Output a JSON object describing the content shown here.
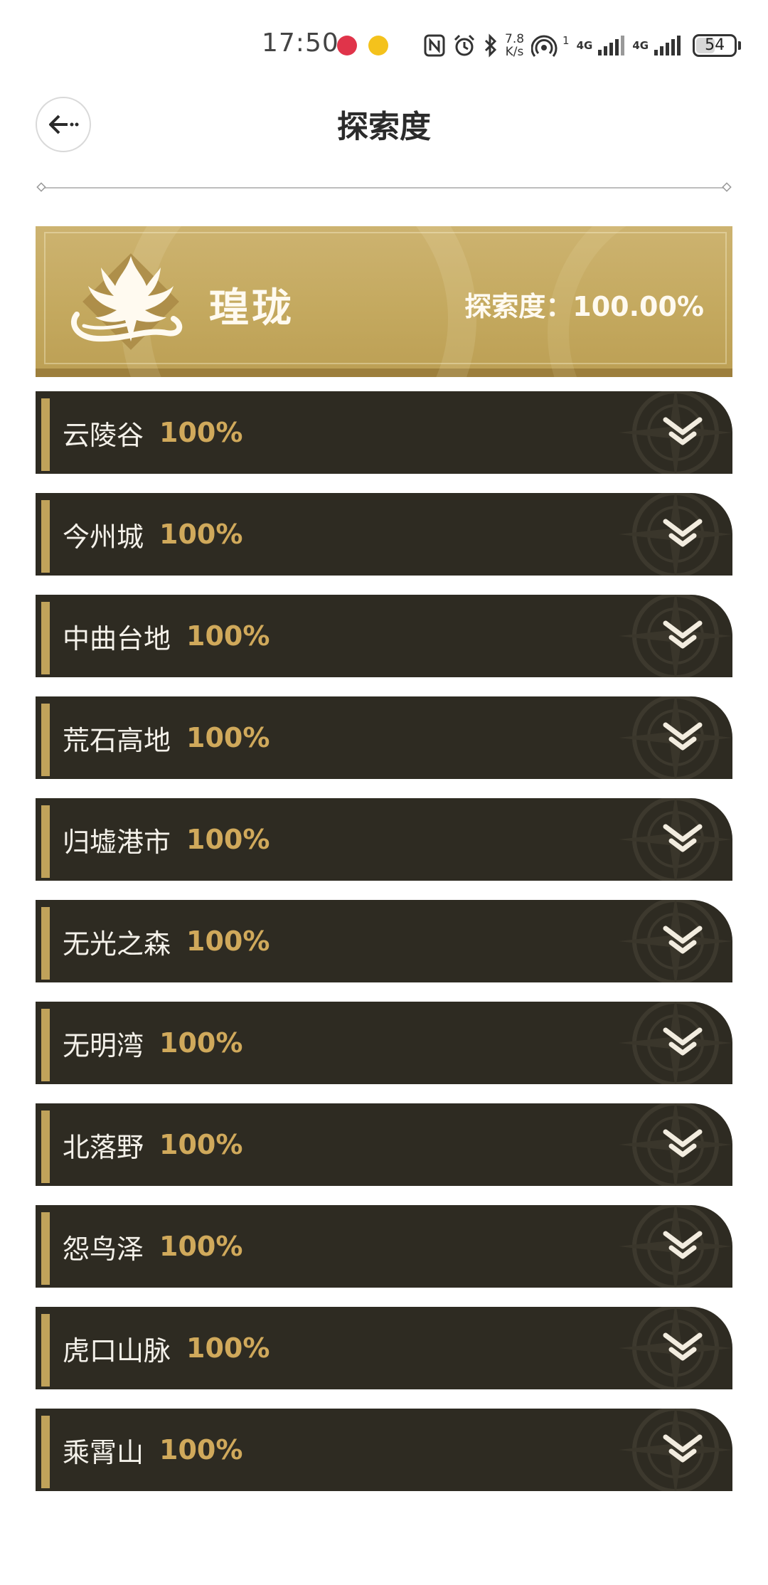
{
  "status_bar": {
    "time": "17:50",
    "net_speed_value": "7.8",
    "net_speed_unit": "K/s",
    "wifi_badge": "1",
    "net_type_1": "4G",
    "net_type_2": "4G",
    "battery_level": "54",
    "battery_fraction": 0.54
  },
  "header": {
    "title": "探索度",
    "back_icon": "back-arrow-icon"
  },
  "region": {
    "name": "瑝珑",
    "progress_label": "探索度：100.00%",
    "emblem_icon": "dragon-emblem-icon"
  },
  "areas": [
    {
      "name": "云陵谷",
      "percent": "100%"
    },
    {
      "name": "今州城",
      "percent": "100%"
    },
    {
      "name": "中曲台地",
      "percent": "100%"
    },
    {
      "name": "荒石高地",
      "percent": "100%"
    },
    {
      "name": "归墟港市",
      "percent": "100%"
    },
    {
      "name": "无光之森",
      "percent": "100%"
    },
    {
      "name": "无明湾",
      "percent": "100%"
    },
    {
      "name": "北落野",
      "percent": "100%"
    },
    {
      "name": "怨鸟泽",
      "percent": "100%"
    },
    {
      "name": "虎口山脉",
      "percent": "100%"
    },
    {
      "name": "乘霄山",
      "percent": "100%"
    }
  ],
  "colors": {
    "banner_gold": "#c4a95f",
    "item_background": "#2e2b22",
    "accent_gold": "#c0a25a",
    "percent_gold": "#d0a95b",
    "item_text": "#f4f1ea"
  }
}
